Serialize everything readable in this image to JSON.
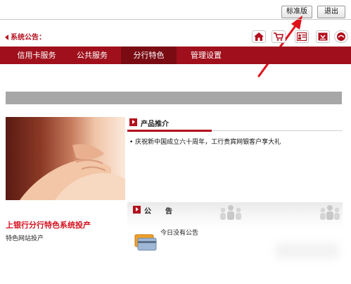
{
  "toolbar": {
    "standard_label": "标准版",
    "logout_label": "退出"
  },
  "notice": {
    "label": "系统公告："
  },
  "quick_icons": [
    "home-icon",
    "cart-icon",
    "user-card-icon",
    "download-icon",
    "mail-icon"
  ],
  "nav": {
    "items": [
      {
        "label": "信用卡服务"
      },
      {
        "label": "公共服务"
      },
      {
        "label": "分行特色"
      },
      {
        "label": "管理设置"
      }
    ],
    "active_index": 2
  },
  "promo": {
    "headline": "上银行分行特色系统投产",
    "subline": "特色网站投产"
  },
  "products": {
    "title": "产品推介",
    "items": [
      "• 庆祝新中国成立六十周年，工行贵宾网银客户享大礼"
    ]
  },
  "announcement": {
    "title": "公　　告",
    "message": "今日没有公告"
  },
  "colors": {
    "brand_red": "#a0101c",
    "nav_active": "#7a0b13",
    "accent_red": "#d4121f"
  }
}
